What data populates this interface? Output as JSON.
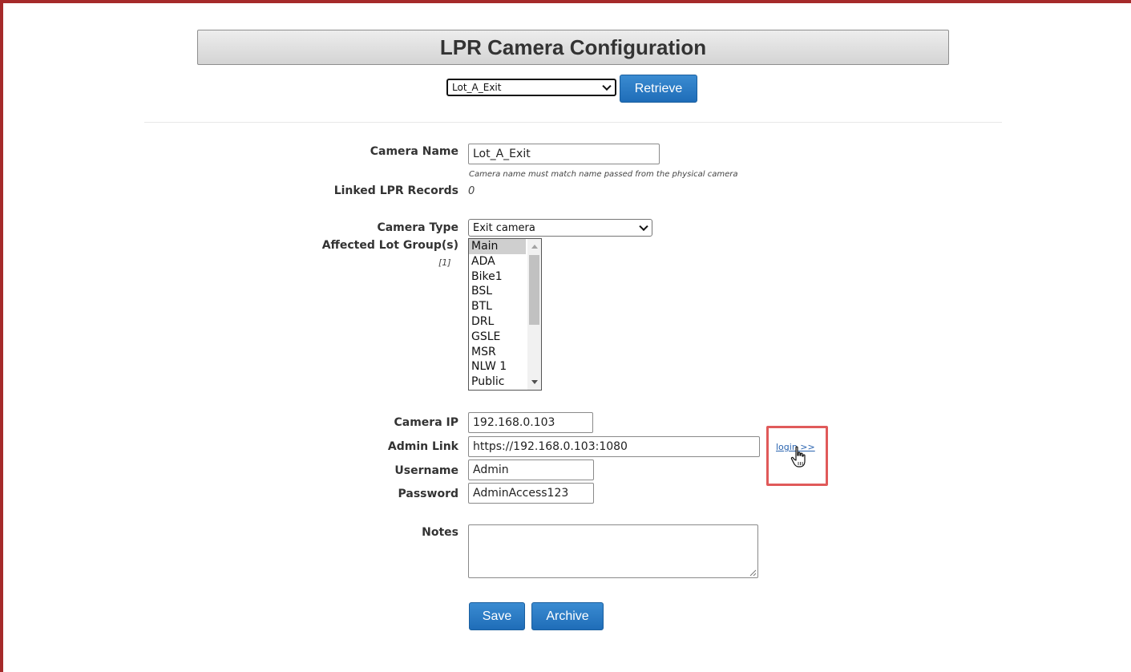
{
  "header": {
    "title": "LPR Camera Configuration"
  },
  "camera_picker": {
    "selected": "Lot_A_Exit",
    "retrieve_label": "Retrieve"
  },
  "form": {
    "camera_name": {
      "label": "Camera Name",
      "value": "Lot_A_Exit",
      "hint": "Camera name must match name passed from the physical camera"
    },
    "linked_records": {
      "label": "Linked LPR Records",
      "value": "0"
    },
    "camera_type": {
      "label": "Camera Type",
      "value": "Exit camera"
    },
    "lot_groups": {
      "label": "Affected Lot Group(s)",
      "count": "[1]",
      "options": [
        "Main",
        "ADA",
        "Bike1",
        "BSL",
        "BTL",
        "DRL",
        "GSLE",
        "MSR",
        "NLW 1",
        "Public"
      ],
      "selected": "Main"
    },
    "camera_ip": {
      "label": "Camera IP",
      "value": "192.168.0.103"
    },
    "admin_link": {
      "label": "Admin Link",
      "value": "https://192.168.0.103:1080",
      "link_text": "login >>"
    },
    "username": {
      "label": "Username",
      "value": "Admin"
    },
    "password": {
      "label": "Password",
      "value": "AdminAccess123"
    },
    "notes": {
      "label": "Notes",
      "value": ""
    }
  },
  "actions": {
    "save_label": "Save",
    "archive_label": "Archive"
  },
  "icons": {
    "cursor": "hand-pointer-icon",
    "resize": "resize-grip-icon",
    "dropdown": "chevron-down-icon"
  },
  "colors": {
    "accent": "#2a77c4",
    "frame": "#a52a2a",
    "highlight": "#e05a5a",
    "link": "#2a64b0"
  }
}
